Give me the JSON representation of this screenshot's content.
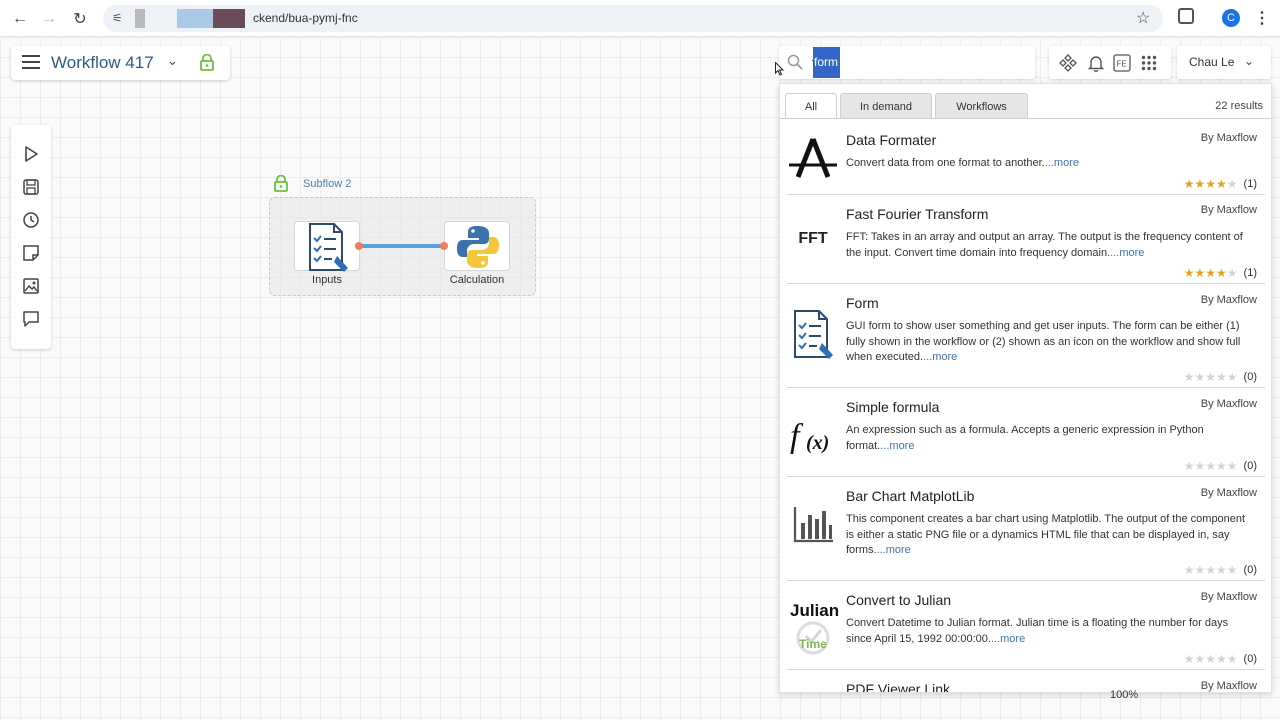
{
  "browser": {
    "url_suffix": "ckend/bua-pymj-fnc",
    "profile_initial": "C"
  },
  "workflow": {
    "title": "Workflow 417"
  },
  "subflow": {
    "label": "Subflow 2",
    "nodes": [
      {
        "label": "Inputs",
        "icon": "form-icon"
      },
      {
        "label": "Calculation",
        "icon": "python-icon"
      }
    ]
  },
  "search": {
    "value": "form"
  },
  "user": {
    "name": "Chau Le"
  },
  "tabs": [
    {
      "label": "All",
      "active": true
    },
    {
      "label": "In demand",
      "active": false
    },
    {
      "label": "Workflows",
      "active": false
    }
  ],
  "results_count": "22 results",
  "results": [
    {
      "title": "Data Formater",
      "by": "By Maxflow",
      "desc": "Convert data from one format to another.",
      "more": "...more",
      "stars": 4,
      "count": "(1)",
      "icon": "A"
    },
    {
      "title": "Fast Fourier Transform",
      "by": "By Maxflow",
      "desc": "FFT: Takes in an array and output an array. The output is the frequency content of the input. Convert time domain into frequency domain.",
      "more": "...more",
      "stars": 4,
      "count": "(1)",
      "icon": "FFT"
    },
    {
      "title": "Form",
      "by": "By Maxflow",
      "desc": "GUI form to show user something and get user inputs. The form can be either (1) fully shown in the workflow or (2) shown as an icon on the workflow and show full when executed.",
      "more": "...more",
      "stars": 0,
      "count": "(0)",
      "icon": "form"
    },
    {
      "title": "Simple formula",
      "by": "By Maxflow",
      "desc": "An expression such as a formula. Accepts a generic expression in Python format.",
      "more": "...more",
      "stars": 0,
      "count": "(0)",
      "icon": "f(x)"
    },
    {
      "title": "Bar Chart MatplotLib",
      "by": "By Maxflow",
      "desc": "This component creates a bar chart using Matplotlib. The output of the component is either a static PNG file or a dynamics HTML file that can be displayed in, say forms.",
      "more": "...more",
      "stars": 0,
      "count": "(0)",
      "icon": "bar-chart"
    },
    {
      "title": "Convert to Julian",
      "by": "By Maxflow",
      "desc": "Convert Datetime to Julian format. Julian time is a floating the number for days since April 15, 1992 00:00:00.",
      "more": "...more",
      "stars": 0,
      "count": "(0)",
      "icon_text_top": "Julian",
      "icon_text_bottom": "Time"
    },
    {
      "title": "PDF Viewer Link",
      "by": "By Maxflow"
    }
  ],
  "zoom": "100%",
  "colors": {
    "accent": "#2c5a8f",
    "lock_green": "#6abf3a",
    "link": "#3d72b5",
    "star": "#e0a423",
    "connector": "#5aa0dc",
    "port": "#f07a5a"
  }
}
